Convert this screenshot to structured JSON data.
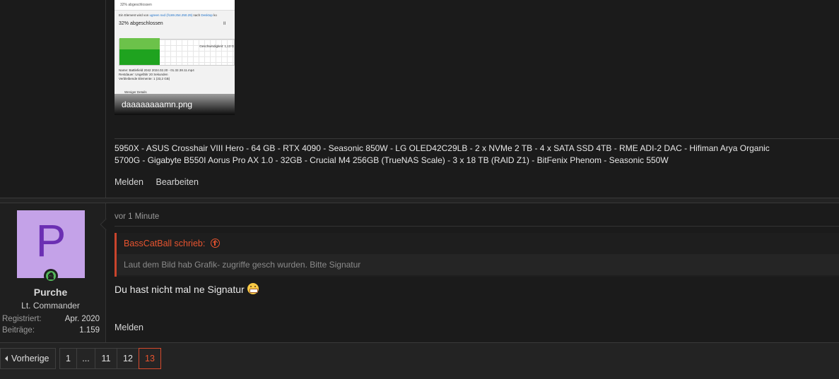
{
  "post1": {
    "attachment": {
      "filename": "daaaaaaaamn.png",
      "window_title": "32% abgeschlossen",
      "line1_prefix": "Ein Element wird von",
      "line1_link1": "ugreen nxd (\\\\169.254.250.29)",
      "line1_mid": "nach",
      "line1_link2": "Desktop",
      "line1_suffix": "ko",
      "progress_heading": "32% abgeschlossen",
      "pause_glyph": "II",
      "speed": "Geschwindigkeit: 1,13 G",
      "progress": 0.32,
      "name_line": "Name: Battlefield 2042 2024.02.20 - 01.32.38.11.mp4",
      "remaining_line": "Restdauer: Ungefähr 20 Sekunden",
      "items_line": "Verbleibende Elemente: 1 (33,2 GB)",
      "details_toggle": "Weniger Details"
    },
    "signature": [
      "5950X - ASUS Crosshair VIII Hero - 64 GB - RTX 4090 - Seasonic 850W - LG OLED42C29LB - 2 x NVMe 2 TB - 4 x SATA SSD 4TB - RME ADI-2 DAC - Hifiman Arya Organic",
      "5700G - Gigabyte B550I Aorus Pro AX 1.0 - 32GB - Crucial M4 256GB (TrueNAS Scale) - 3 x 18 TB (RAID Z1) - BitFenix Phenom - Seasonic 550W"
    ],
    "actions": {
      "report": "Melden",
      "edit": "Bearbeiten"
    }
  },
  "post2": {
    "user": {
      "avatar_letter": "P",
      "avatar_color": "#c4a2e8",
      "online_icon": "online-status-icon",
      "name": "Purche",
      "title": "Lt. Commander",
      "registered_label": "Registriert:",
      "registered_value": "Apr. 2020",
      "posts_label": "Beiträge:",
      "posts_value": "1.159"
    },
    "time": "vor 1 Minute",
    "quote": {
      "author": "BassCatBall schrieb:",
      "icon": "arrow-up-circle-icon",
      "text": "Laut dem Bild hab Grafik- zugriffe gesch wurden. Bitte Signatur"
    },
    "message": "Du hast nicht mal ne Signatur",
    "emoji": "grimacing-emoji-icon",
    "actions": {
      "report": "Melden"
    }
  },
  "pagination": {
    "prev_label": "Vorherige",
    "pages": [
      "1",
      "...",
      "11",
      "12",
      "13"
    ],
    "active": "13",
    "accent": "#e8542f"
  }
}
